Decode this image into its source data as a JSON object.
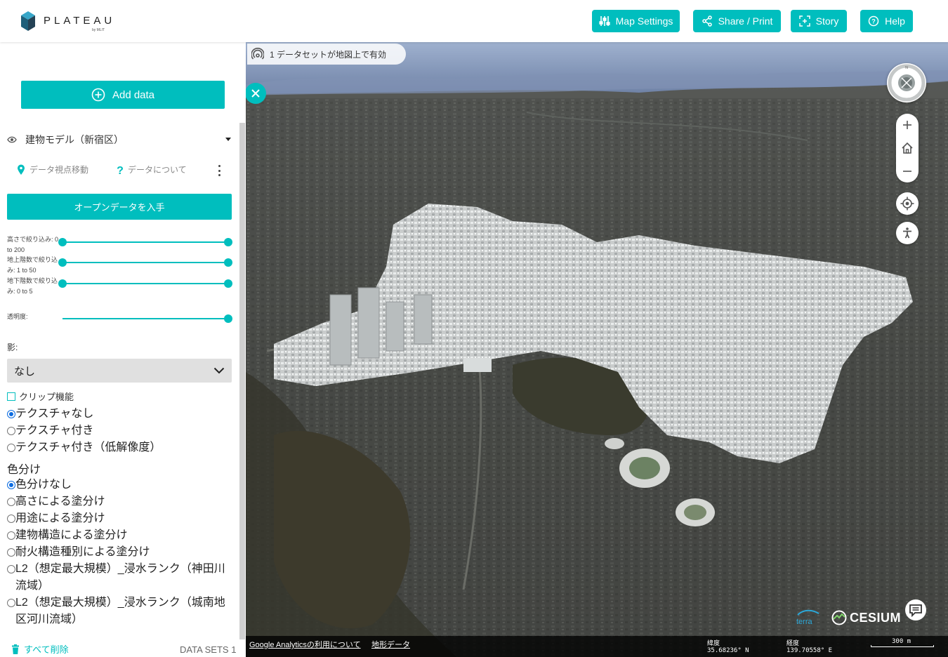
{
  "header": {
    "logo_text": "PLATEAU",
    "logo_subtext": "by MLIT",
    "buttons": [
      {
        "label": "Map Settings",
        "icon": "sliders-icon"
      },
      {
        "label": "Share / Print",
        "icon": "share-icon"
      },
      {
        "label": "Story",
        "icon": "story-icon"
      },
      {
        "label": "Help",
        "icon": "help-icon"
      }
    ]
  },
  "sidebar": {
    "add_data_label": "Add data",
    "layer": {
      "title": "建物モデル（新宿区）",
      "move_view_label": "データ視点移動",
      "about_label": "データについて",
      "get_opendata_label": "オープンデータを入手",
      "sliders": [
        {
          "label": "高さで絞り込み: 0 to 200",
          "min": 0,
          "max": 200,
          "low": 0,
          "high": 200
        },
        {
          "label": "地上階数で絞り込み: 1 to 50",
          "min": 1,
          "max": 50,
          "low": 1,
          "high": 50
        },
        {
          "label": "地下階数で絞り込み: 0 to 5",
          "min": 0,
          "max": 5,
          "low": 0,
          "high": 5
        }
      ],
      "opacity_label": "透明度:",
      "opacity_value": 1,
      "shadow_label": "影:",
      "shadow_value": "なし",
      "clip_label": "クリップ機能",
      "texture_options": [
        {
          "label": "テクスチャなし",
          "selected": true
        },
        {
          "label": "テクスチャ付き",
          "selected": false
        },
        {
          "label": "テクスチャ付き（低解像度）",
          "selected": false
        }
      ],
      "color_title": "色分け",
      "color_options": [
        {
          "label": "色分けなし",
          "selected": true
        },
        {
          "label": "高さによる塗分け",
          "selected": false
        },
        {
          "label": "用途による塗分け",
          "selected": false
        },
        {
          "label": "建物構造による塗分け",
          "selected": false
        },
        {
          "label": "耐火構造種別による塗分け",
          "selected": false
        },
        {
          "label": "L2（想定最大規模）_浸水ランク（神田川流域）",
          "selected": false
        },
        {
          "label": "L2（想定最大規模）_浸水ランク（城南地区河川流域）",
          "selected": false
        }
      ]
    },
    "delete_all_label": "すべて削除",
    "datasets_count_label": "DATA SETS 1"
  },
  "map": {
    "dataset_pill": "1 データセットが地図上で有効",
    "footer": {
      "analytics_link": "Google Analyticsの利用について",
      "terrain_link": "地形データ",
      "lat_label": "緯度",
      "lat_value": "35.68236° N",
      "lon_label": "経度",
      "lon_value": "139.70558° E",
      "scale_label": "300 m"
    },
    "terra_logo": "terra",
    "cesium_logo": "CESIUM",
    "colors": {
      "accent": "#00BEBE",
      "footer_bg": "#000000"
    }
  }
}
